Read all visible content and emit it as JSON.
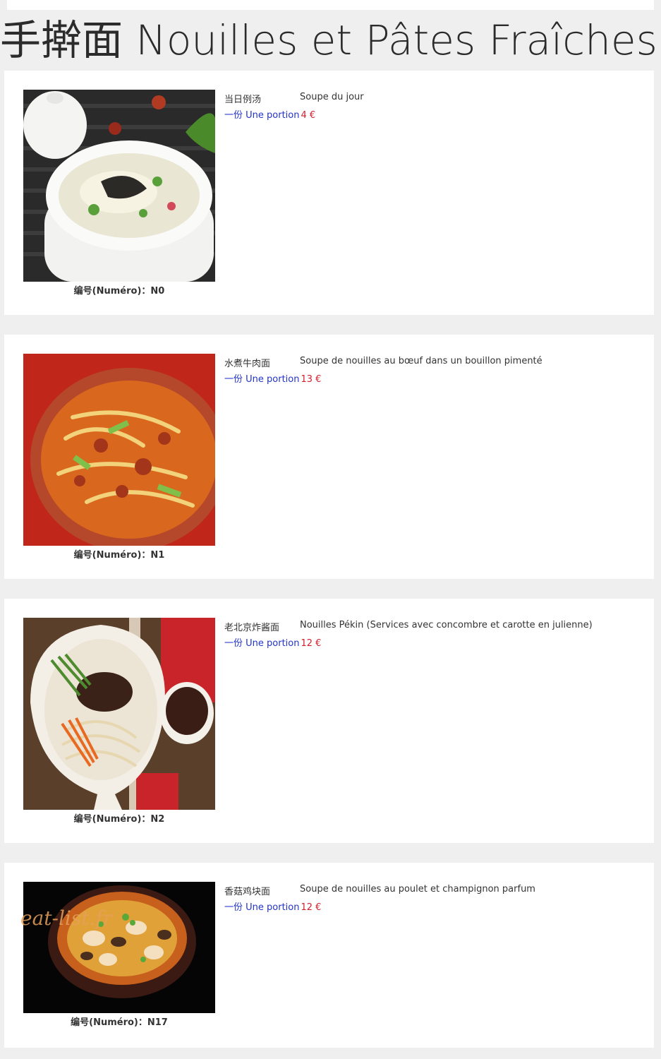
{
  "page": {
    "title": "手擀面 Nouilles et Pâtes Fraîches",
    "watermark": "eat-list.fr"
  },
  "colors": {
    "background": "#efefef",
    "card": "#ffffff",
    "portion_blue": "#2233cc",
    "price_red": "#d0202e",
    "text": "#333333"
  },
  "dishes": [
    {
      "numero": "编号(Numéro)：N0",
      "name_cn": "当日例汤",
      "name_fr": "Soupe du jour",
      "portion_label": "一份 Une portion",
      "price": "4 €",
      "photo_icon": "soup-bowl-photo"
    },
    {
      "numero": "编号(Numéro)：N1",
      "name_cn": "水煮牛肉面",
      "name_fr": "Soupe de nouilles au bœuf dans un bouillon pimenté",
      "portion_label": "一份 Une portion",
      "price": "13 €",
      "photo_icon": "spicy-noodle-photo"
    },
    {
      "numero": "编号(Numéro)：N2",
      "name_cn": "老北京炸酱面",
      "name_fr": "Nouilles Pékin (Services avec concombre et carotte en julienne)",
      "portion_label": "一份 Une portion",
      "price": "12 €",
      "photo_icon": "zhajiang-noodle-photo"
    },
    {
      "numero": "编号(Numéro)：N17",
      "name_cn": "香菇鸡块面",
      "name_fr": "Soupe de nouilles au poulet et champignon parfum",
      "portion_label": "一份 Une portion",
      "price": "12 €",
      "photo_icon": "chicken-mushroom-noodle-photo"
    }
  ]
}
